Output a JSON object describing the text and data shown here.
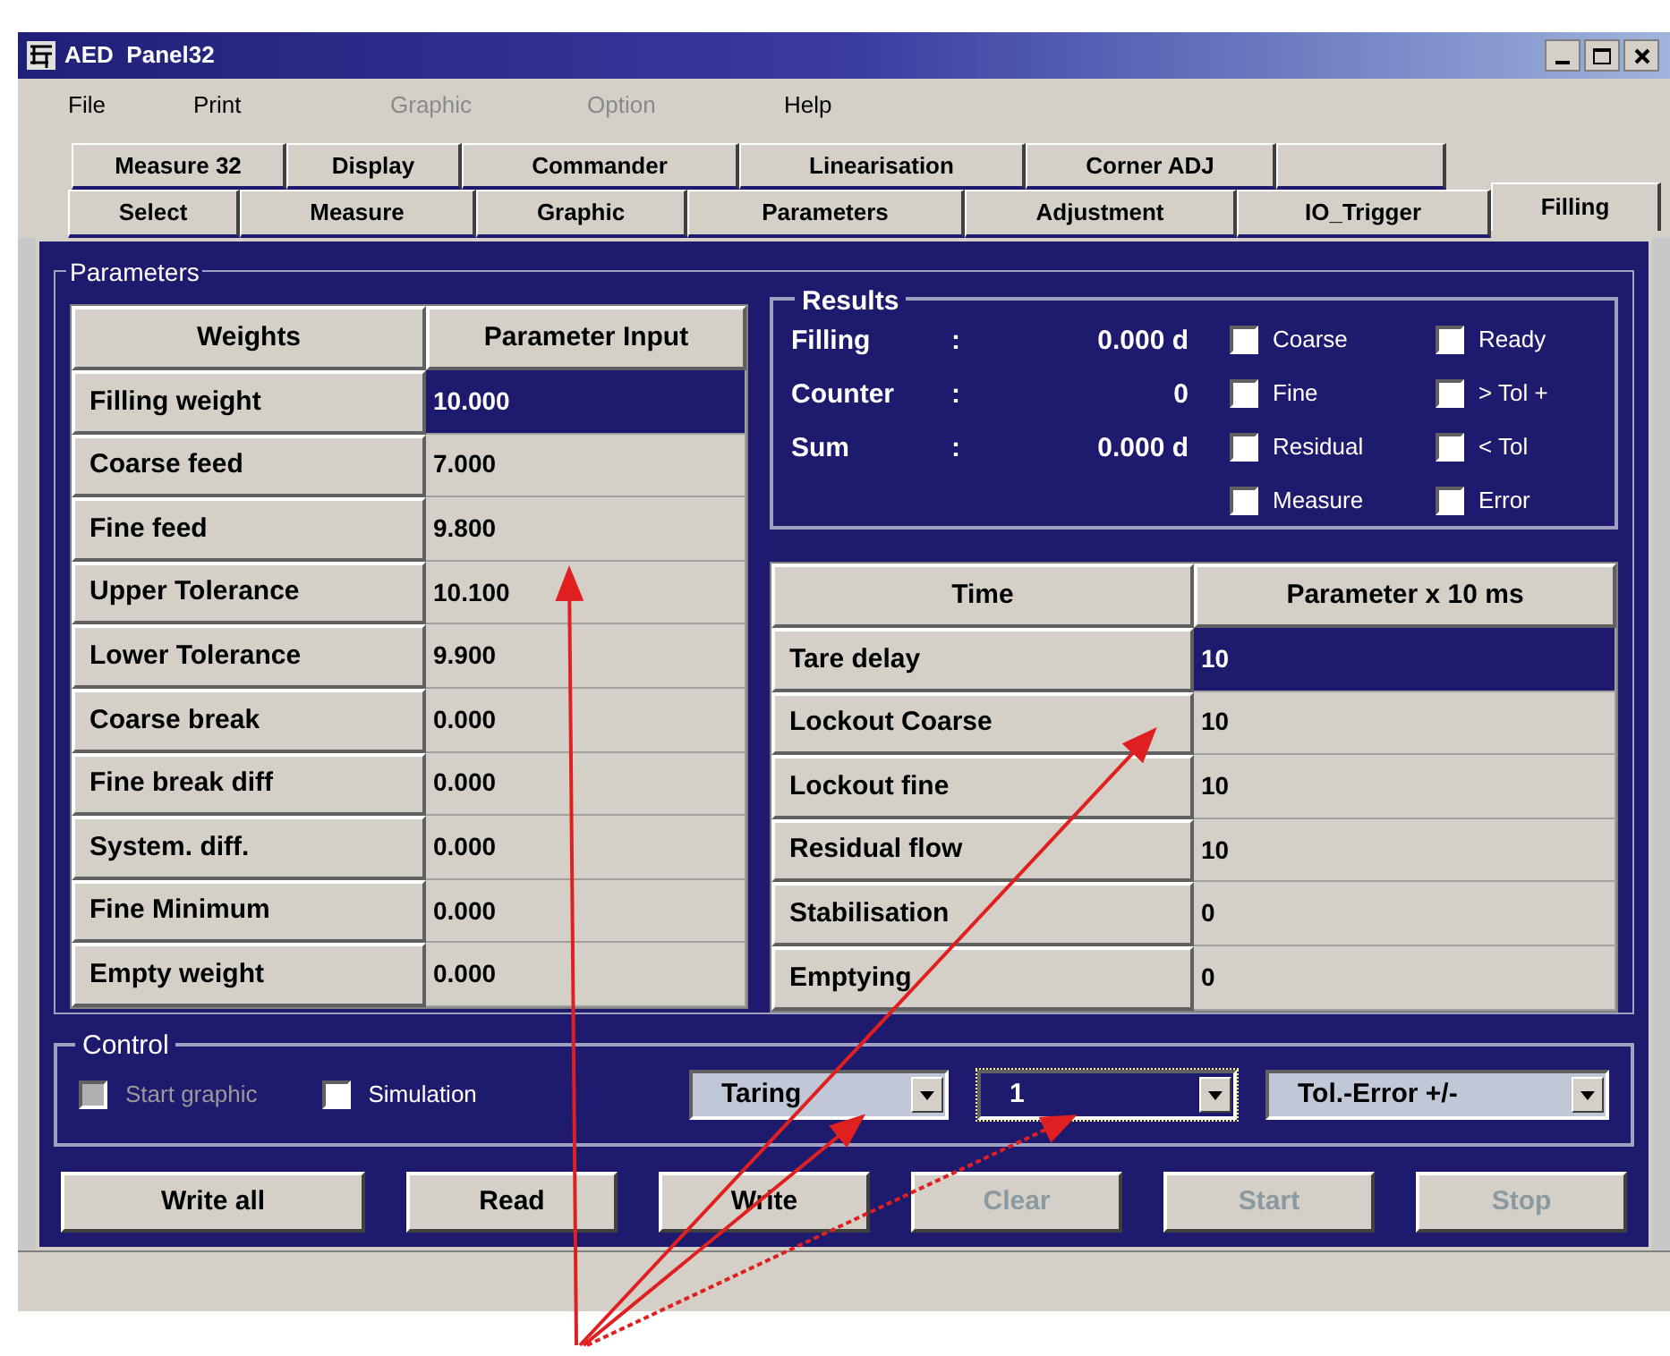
{
  "window": {
    "title": "AED  Panel32"
  },
  "menu": [
    {
      "label": "File",
      "disabled": false
    },
    {
      "label": "Print",
      "disabled": false
    },
    {
      "label": "Graphic",
      "disabled": true
    },
    {
      "label": "Option",
      "disabled": true
    },
    {
      "label": "Help",
      "disabled": false
    }
  ],
  "tabs_row_1": [
    {
      "label": "Measure 32",
      "selected": false
    },
    {
      "label": "Display",
      "selected": false
    },
    {
      "label": "Commander",
      "selected": false
    },
    {
      "label": "Linearisation",
      "selected": false
    },
    {
      "label": "Corner ADJ",
      "selected": false
    }
  ],
  "tabs_row_2": [
    {
      "label": "Select",
      "selected": false
    },
    {
      "label": "Measure",
      "selected": false
    },
    {
      "label": "Graphic",
      "selected": false
    },
    {
      "label": "Parameters",
      "selected": false
    },
    {
      "label": "Adjustment",
      "selected": false
    },
    {
      "label": "IO_Trigger",
      "selected": false
    },
    {
      "label": "Filling",
      "selected": true
    }
  ],
  "parameters": {
    "title": "Parameters",
    "weights_table": {
      "columns": [
        "Weights",
        "Parameter Input"
      ],
      "rows": [
        {
          "name": "Filling weight",
          "value": "10.000",
          "selected": true
        },
        {
          "name": "Coarse feed",
          "value": "7.000",
          "selected": false
        },
        {
          "name": "Fine feed",
          "value": "9.800",
          "selected": false
        },
        {
          "name": "Upper Tolerance",
          "value": "10.100",
          "selected": false
        },
        {
          "name": "Lower Tolerance",
          "value": "9.900",
          "selected": false
        },
        {
          "name": "Coarse break",
          "value": "0.000",
          "selected": false
        },
        {
          "name": "Fine break diff",
          "value": "0.000",
          "selected": false
        },
        {
          "name": "System. diff.",
          "value": "0.000",
          "selected": false
        },
        {
          "name": "Fine Minimum",
          "value": "0.000",
          "selected": false
        },
        {
          "name": "Empty weight",
          "value": "0.000",
          "selected": false
        }
      ]
    },
    "results": {
      "title": "Results",
      "readings": [
        {
          "label": "Filling",
          "sep": ":",
          "value": "0.000 d"
        },
        {
          "label": "Counter",
          "sep": ":",
          "value": "0"
        },
        {
          "label": "Sum",
          "sep": ":",
          "value": "0.000 d"
        }
      ],
      "flags": [
        {
          "label": "Coarse",
          "checked": false
        },
        {
          "label": "Ready",
          "checked": false
        },
        {
          "label": "Fine",
          "checked": false
        },
        {
          "label": "> Tol +",
          "checked": false
        },
        {
          "label": "Residual",
          "checked": false
        },
        {
          "label": "< Tol",
          "checked": false
        },
        {
          "label": "Measure",
          "checked": false
        },
        {
          "label": "Error",
          "checked": false
        }
      ]
    },
    "time_table": {
      "columns": [
        "Time",
        "Parameter x 10 ms"
      ],
      "rows": [
        {
          "name": "Tare delay",
          "value": "10",
          "selected": true
        },
        {
          "name": "Lockout Coarse",
          "value": "10",
          "selected": false
        },
        {
          "name": "Lockout fine",
          "value": "10",
          "selected": false
        },
        {
          "name": "Residual flow",
          "value": "10",
          "selected": false
        },
        {
          "name": "Stabilisation",
          "value": "0",
          "selected": false
        },
        {
          "name": "Emptying",
          "value": "0",
          "selected": false
        }
      ]
    }
  },
  "control": {
    "title": "Control",
    "checkboxes": [
      {
        "label": "Start graphic",
        "checked": false,
        "disabled": true
      },
      {
        "label": "Simulation",
        "checked": false,
        "disabled": false
      }
    ],
    "dropdowns": [
      {
        "value": "Taring",
        "selected": false
      },
      {
        "value": "1",
        "selected": true
      },
      {
        "value": "Tol.-Error +/-",
        "selected": false
      }
    ]
  },
  "buttons": [
    {
      "label": "Write all",
      "disabled": false
    },
    {
      "label": "Read",
      "disabled": false
    },
    {
      "label": "Write",
      "disabled": false
    },
    {
      "label": "Clear",
      "disabled": true
    },
    {
      "label": "Start",
      "disabled": true
    },
    {
      "label": "Stop",
      "disabled": true
    }
  ]
}
